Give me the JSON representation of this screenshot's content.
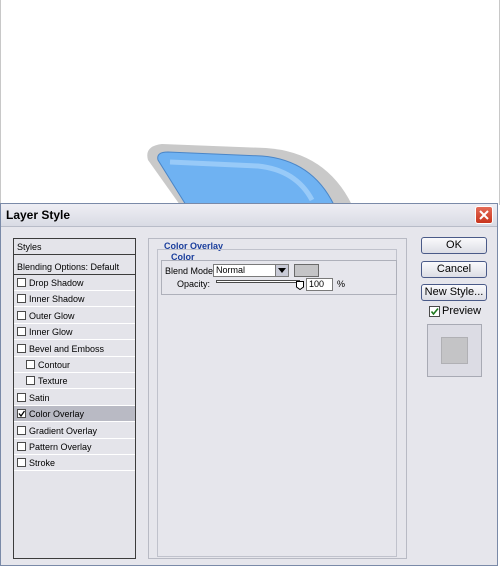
{
  "colors": {
    "logo_fill": "#6fb2f2",
    "logo_outline": "#c9c9c9",
    "overlay_color": "#c4c4c6",
    "legend_blue": "#1a3e9c",
    "selected_row": "#b9bac4"
  },
  "dialog": {
    "title": "Layer Style",
    "close_icon": "close-icon"
  },
  "styles_list": {
    "header": "Styles",
    "blending_options": "Blending Options: Default",
    "items": [
      {
        "label": "Drop Shadow",
        "checked": false,
        "sub": false
      },
      {
        "label": "Inner Shadow",
        "checked": false,
        "sub": false
      },
      {
        "label": "Outer Glow",
        "checked": false,
        "sub": false
      },
      {
        "label": "Inner Glow",
        "checked": false,
        "sub": false
      },
      {
        "label": "Bevel and Emboss",
        "checked": false,
        "sub": false
      },
      {
        "label": "Contour",
        "checked": false,
        "sub": true
      },
      {
        "label": "Texture",
        "checked": false,
        "sub": true
      },
      {
        "label": "Satin",
        "checked": false,
        "sub": false
      },
      {
        "label": "Color Overlay",
        "checked": true,
        "sub": false,
        "selected": true
      },
      {
        "label": "Gradient Overlay",
        "checked": false,
        "sub": false
      },
      {
        "label": "Pattern Overlay",
        "checked": false,
        "sub": false
      },
      {
        "label": "Stroke",
        "checked": false,
        "sub": false
      }
    ]
  },
  "color_overlay": {
    "section_title": "Color Overlay",
    "group_title": "Color",
    "blend_mode_label": "Blend Mode:",
    "blend_mode_value": "Normal",
    "opacity_label": "Opacity:",
    "opacity_value": "100",
    "opacity_unit": "%",
    "opacity_fraction": 1.0
  },
  "buttons": {
    "ok": "OK",
    "cancel": "Cancel",
    "new_style": "New Style...",
    "preview_label": "Preview",
    "preview_checked": true
  }
}
